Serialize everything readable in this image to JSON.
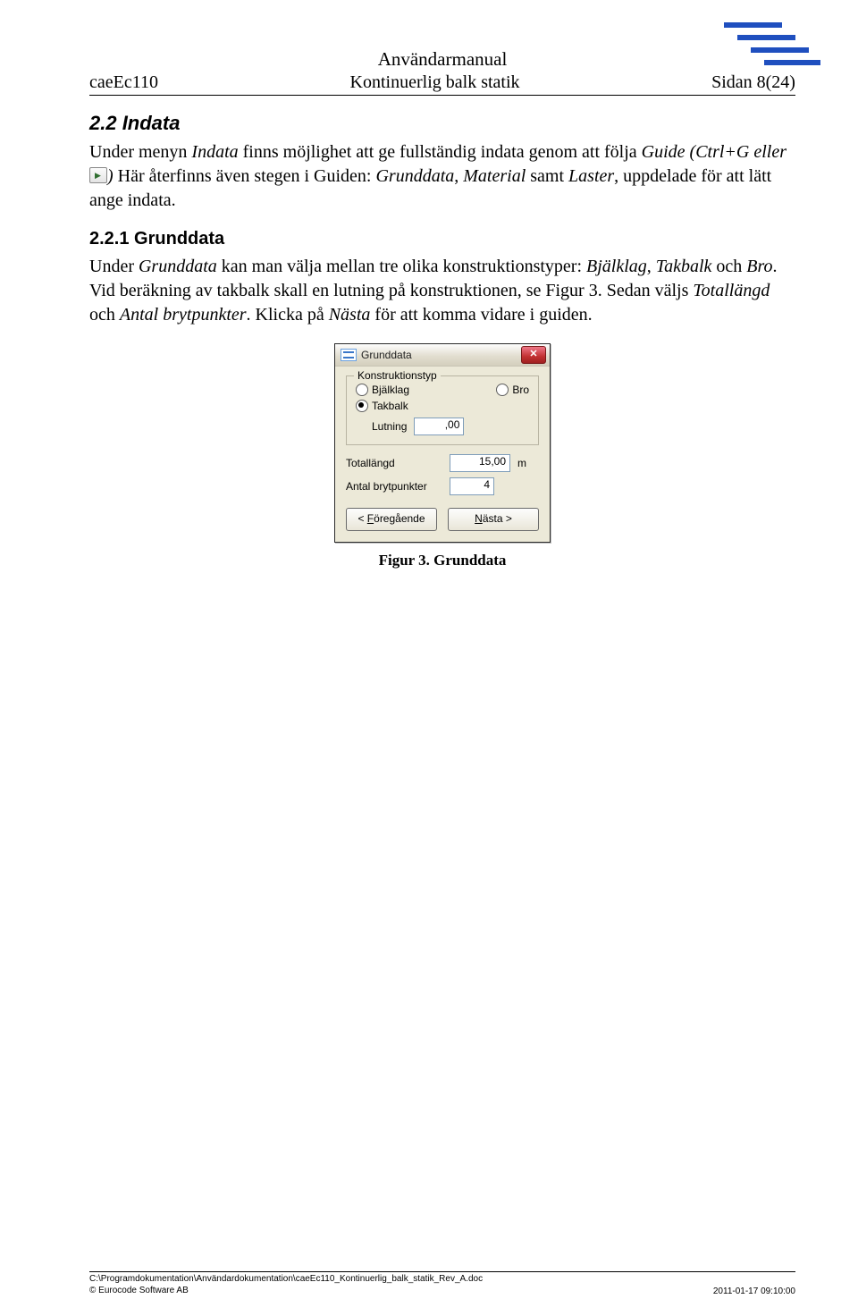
{
  "header": {
    "title": "Användarmanual",
    "left": "caeEc110",
    "mid": "Kontinuerlig balk statik",
    "right": "Sidan 8(24)"
  },
  "sec22": {
    "heading": "2.2  Indata",
    "p1a": "Under menyn ",
    "p1b": "Indata",
    "p1c": " finns möjlighet att ge fullständig indata genom att följa ",
    "p1d": "Guide (Ctrl+G eller ",
    "p1e": ")",
    "p1f": " Här återfinns även stegen i Guiden: ",
    "p1g": "Grunddata",
    "p1h": ", ",
    "p1i": "Material",
    "p1j": " samt ",
    "p1k": "Laster",
    "p1l": ", uppdelade för att lätt ange indata."
  },
  "sec221": {
    "heading": "2.2.1  Grunddata",
    "p1a": "Under ",
    "p1b": "Grunddata",
    "p1c": " kan man välja mellan tre olika konstruktionstyper: ",
    "p1d": "Bjälklag",
    "p1e": ", ",
    "p1f": "Takbalk",
    "p1g": " och ",
    "p1h": "Bro",
    "p1i": ". Vid beräkning av takbalk skall en lutning på konstruktionen, se Figur 3. Sedan väljs ",
    "p1j": "Totallängd",
    "p1k": " och ",
    "p1l": "Antal brytpunkter",
    "p1m": ". Klicka på ",
    "p1n": "Nästa",
    "p1o": " för att komma vidare i guiden."
  },
  "dialog": {
    "title": "Grunddata",
    "close": "✕",
    "group_legend": "Konstruktionstyp",
    "radio_bjalklag": "Bjälklag",
    "radio_bro": "Bro",
    "radio_takbalk": "Takbalk",
    "lutning_label": "Lutning",
    "lutning_value": ",00",
    "totallangd_label": "Totallängd",
    "totallangd_value": "15,00",
    "totallangd_unit": "m",
    "brytpunkter_label": "Antal brytpunkter",
    "brytpunkter_value": "4",
    "prev_pre": "< ",
    "prev_u": "F",
    "prev_post": "öregående",
    "next_u": "N",
    "next_post": "ästa >"
  },
  "caption": "Figur 3. Grunddata",
  "footer": {
    "path": "C:\\Programdokumentation\\Användardokumentation\\caeEc110_Kontinuerlig_balk_statik_Rev_A.doc",
    "copyright": "© Eurocode Software AB",
    "timestamp": "2011-01-17 09:10:00"
  }
}
